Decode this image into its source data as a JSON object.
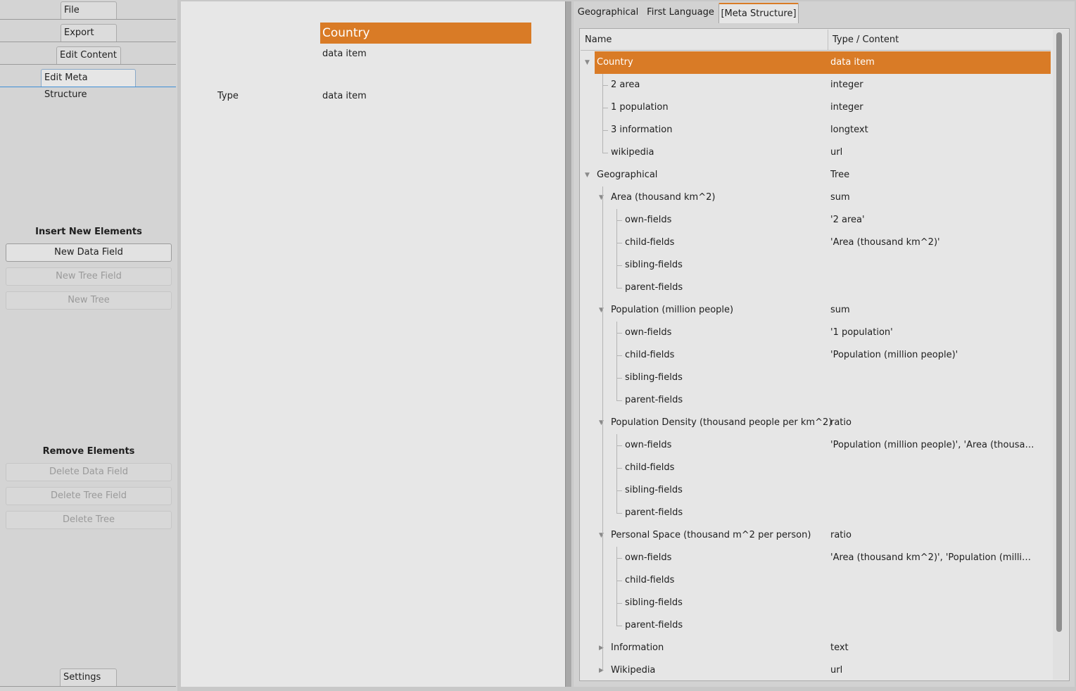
{
  "sidebar": {
    "tabs": {
      "file": "File",
      "export": "Export",
      "edit_content": "Edit Content",
      "edit_meta": "Edit Meta Structure",
      "settings": "Settings"
    },
    "insert_title": "Insert New Elements",
    "insert_buttons": [
      "New Data Field",
      "New Tree Field",
      "New Tree"
    ],
    "remove_title": "Remove Elements",
    "remove_buttons": [
      "Delete Data Field",
      "Delete Tree Field",
      "Delete Tree"
    ]
  },
  "middle": {
    "header": "Country",
    "subtitle": "data item",
    "type_label": "Type",
    "type_value": "data item",
    "accent": "#d97b26"
  },
  "right": {
    "tabs": [
      "Geographical",
      "First Language",
      "[Meta Structure]"
    ],
    "active_tab": "[Meta Structure]",
    "columns": [
      "Name",
      "Type / Content"
    ],
    "rows": [
      {
        "name": "Country",
        "type": "data item",
        "level": 0,
        "expanded": true,
        "selected": true
      },
      {
        "name": "2 area",
        "type": "integer",
        "level": 1
      },
      {
        "name": "1 population",
        "type": "integer",
        "level": 1
      },
      {
        "name": "3 information",
        "type": "longtext",
        "level": 1
      },
      {
        "name": "wikipedia",
        "type": "url",
        "level": 1
      },
      {
        "name": "Geographical",
        "type": "Tree",
        "level": 0,
        "expanded": true
      },
      {
        "name": "Area (thousand km^2)",
        "type": "sum",
        "level": 1,
        "expanded": true
      },
      {
        "name": "own-fields",
        "type": "'2 area'",
        "level": 2
      },
      {
        "name": "child-fields",
        "type": "'Area (thousand km^2)'",
        "level": 2
      },
      {
        "name": "sibling-fields",
        "type": "",
        "level": 2
      },
      {
        "name": "parent-fields",
        "type": "",
        "level": 2
      },
      {
        "name": "Population (million people)",
        "type": "sum",
        "level": 1,
        "expanded": true
      },
      {
        "name": "own-fields",
        "type": "'1 population'",
        "level": 2
      },
      {
        "name": "child-fields",
        "type": "'Population (million people)'",
        "level": 2
      },
      {
        "name": "sibling-fields",
        "type": "",
        "level": 2
      },
      {
        "name": "parent-fields",
        "type": "",
        "level": 2
      },
      {
        "name": "Population Density (thousand people per km^2)",
        "type": "ratio",
        "level": 1,
        "expanded": true
      },
      {
        "name": "own-fields",
        "type": "'Population (million people)', 'Area (thousand ...",
        "level": 2
      },
      {
        "name": "child-fields",
        "type": "",
        "level": 2
      },
      {
        "name": "sibling-fields",
        "type": "",
        "level": 2
      },
      {
        "name": "parent-fields",
        "type": "",
        "level": 2
      },
      {
        "name": "Personal Space (thousand m^2 per person)",
        "type": "ratio",
        "level": 1,
        "expanded": true
      },
      {
        "name": "own-fields",
        "type": "'Area (thousand km^2)', 'Population (million ...",
        "level": 2
      },
      {
        "name": "child-fields",
        "type": "",
        "level": 2
      },
      {
        "name": "sibling-fields",
        "type": "",
        "level": 2
      },
      {
        "name": "parent-fields",
        "type": "",
        "level": 2
      },
      {
        "name": "Information",
        "type": "text",
        "level": 1,
        "expanded": false
      },
      {
        "name": "Wikipedia",
        "type": "url",
        "level": 1,
        "expanded": false
      }
    ]
  }
}
